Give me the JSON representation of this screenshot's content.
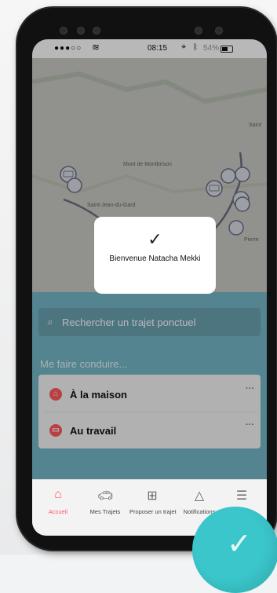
{
  "status": {
    "time": "08:15",
    "battery": "54%",
    "signal": "●●●○○",
    "wifi_icon": "wifi-icon",
    "location_icon": "location-icon",
    "bluetooth_icon": "bluetooth-icon"
  },
  "map": {
    "labels": [
      "Saint-Jean-du-Gard",
      "Mont de Montbrison",
      "Saint",
      "Pierre"
    ]
  },
  "modal": {
    "message": "Bienvenue Natacha Mekki",
    "check_icon": "check-icon"
  },
  "search": {
    "placeholder": "Rechercher un trajet ponctuel"
  },
  "section": {
    "title": "Me faire conduire..."
  },
  "cards": [
    {
      "label": "À la maison",
      "more": "···",
      "icon": "home-icon"
    },
    {
      "label": "Au travail",
      "more": "···",
      "icon": "briefcase-icon"
    }
  ],
  "tabs": [
    {
      "label": "Accueil",
      "icon": "home-icon",
      "active": true
    },
    {
      "label": "Mes Trajets",
      "icon": "car-icon",
      "active": false
    },
    {
      "label": "Proposer un trajet",
      "icon": "plus-square-icon",
      "active": false
    },
    {
      "label": "Notifications",
      "icon": "bell-icon",
      "active": false
    },
    {
      "label": "",
      "icon": "menu-icon",
      "active": false
    }
  ],
  "colors": {
    "accent": "#ff5a5f",
    "fab": "#3ac6cb",
    "panel": "#74b7c8"
  }
}
